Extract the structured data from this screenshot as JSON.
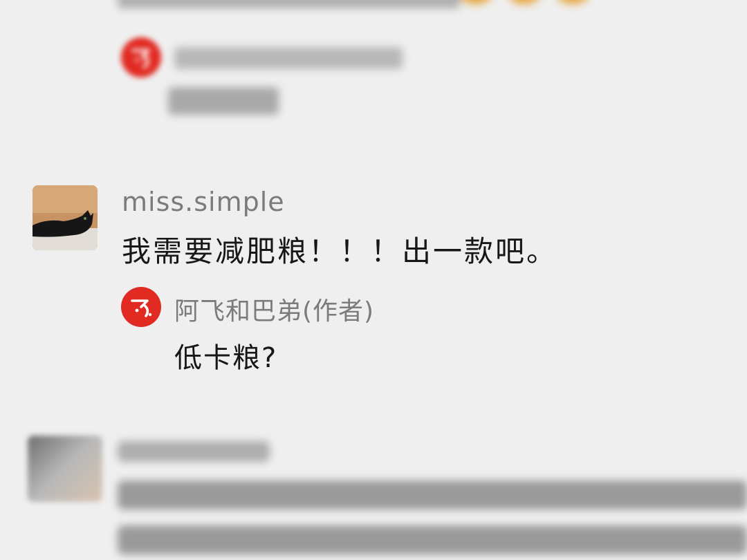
{
  "thread": {
    "top_blurred": {
      "emoji_colors": [
        "#e7a640",
        "#e7a640",
        "#e7a640"
      ]
    },
    "main_comment": {
      "username": "miss.simple",
      "text": "我需要减肥粮！！！出一款吧。",
      "avatar": "cat-photo-avatar"
    },
    "author_reply": {
      "author_name": "阿飞和巴弟(作者)",
      "text": "低卡粮?",
      "logo": "red-fei-logo-icon"
    }
  },
  "colors": {
    "background": "#efefef",
    "brand_red": "#e12a22",
    "name_gray": "#7b7b7b",
    "text_dark": "#171717"
  }
}
